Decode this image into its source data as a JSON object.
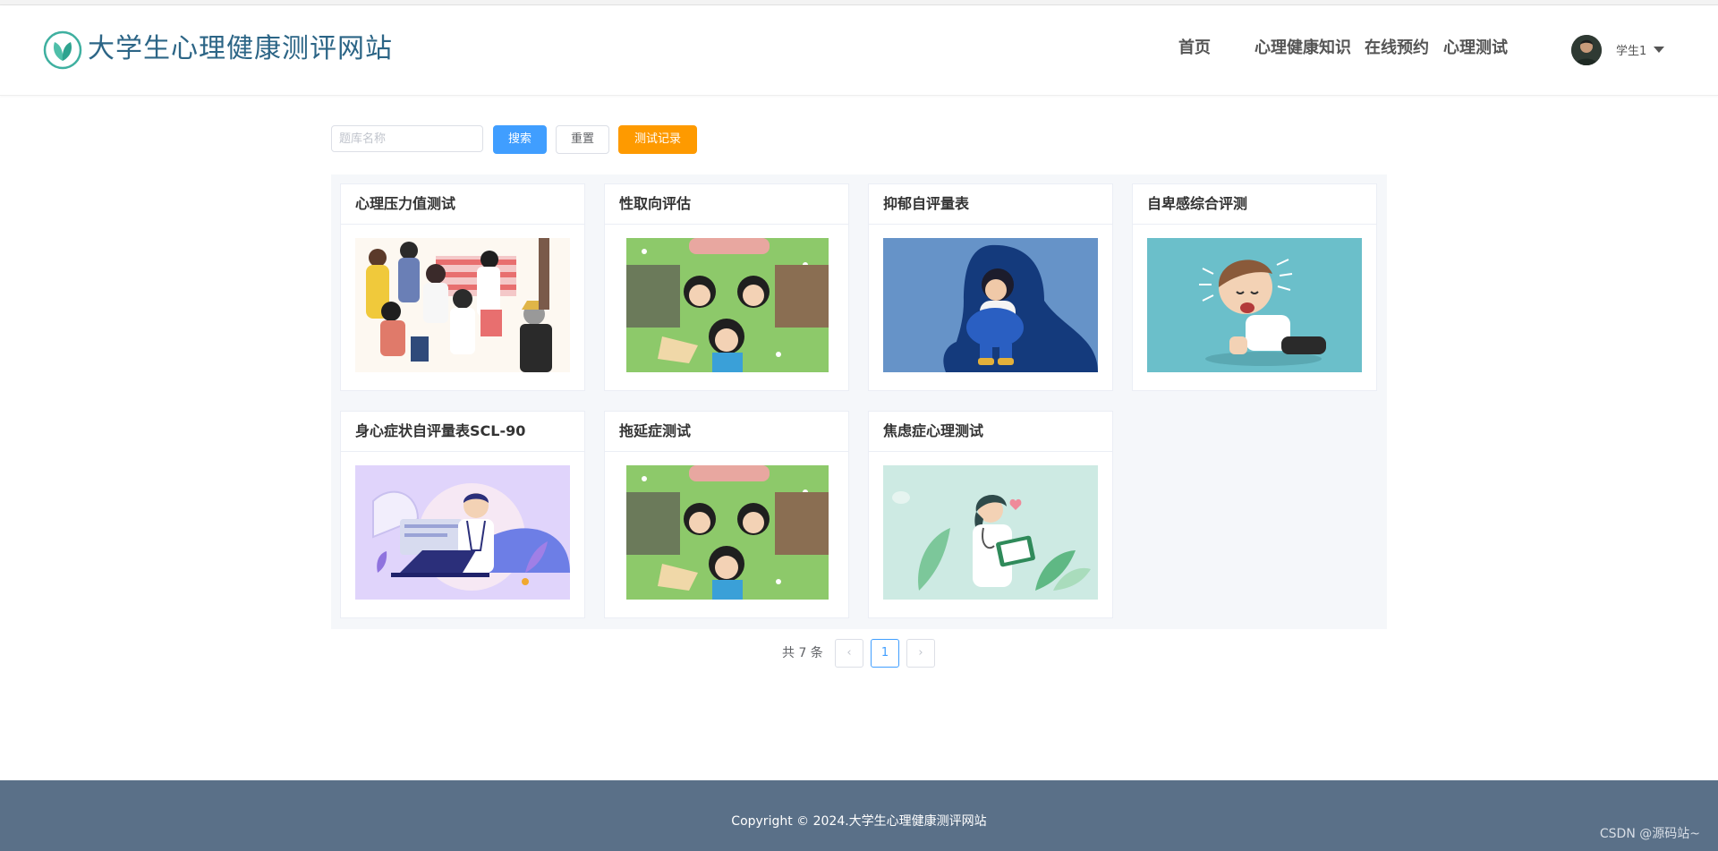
{
  "header": {
    "site_title": "大学生心理健康测评网站",
    "nav": [
      "首页",
      "心理健康知识",
      "在线预约",
      "心理测试"
    ],
    "user_name": "学生1",
    "brand_color": "#2c6586"
  },
  "toolbar": {
    "search_placeholder": "题库名称",
    "search_value": "",
    "search_label": "搜索",
    "reset_label": "重置",
    "record_label": "测试记录",
    "search_color": "#409eff",
    "record_color": "#fe9a00"
  },
  "cards": [
    {
      "title": "心理压力值测试",
      "image_icon": "crowd-illustration"
    },
    {
      "title": "性取向评估",
      "image_icon": "lying-people-illustration"
    },
    {
      "title": "抑郁自评量表",
      "image_icon": "sad-person-illustration"
    },
    {
      "title": "自卑感综合评测",
      "image_icon": "crying-boy-illustration"
    },
    {
      "title": "身心症状自评量表SCL-90",
      "image_icon": "doctor-laptop-illustration"
    },
    {
      "title": "拖延症测试",
      "image_icon": "lying-people-illustration"
    },
    {
      "title": "焦虑症心理测试",
      "image_icon": "nurse-illustration"
    }
  ],
  "pagination": {
    "total_text": "共 7 条",
    "current_page": "1",
    "prev_icon": "‹",
    "next_icon": "›"
  },
  "footer": {
    "copyright": "Copyright © 2024.大学生心理健康测评网站",
    "watermark": "CSDN @源码站~"
  }
}
